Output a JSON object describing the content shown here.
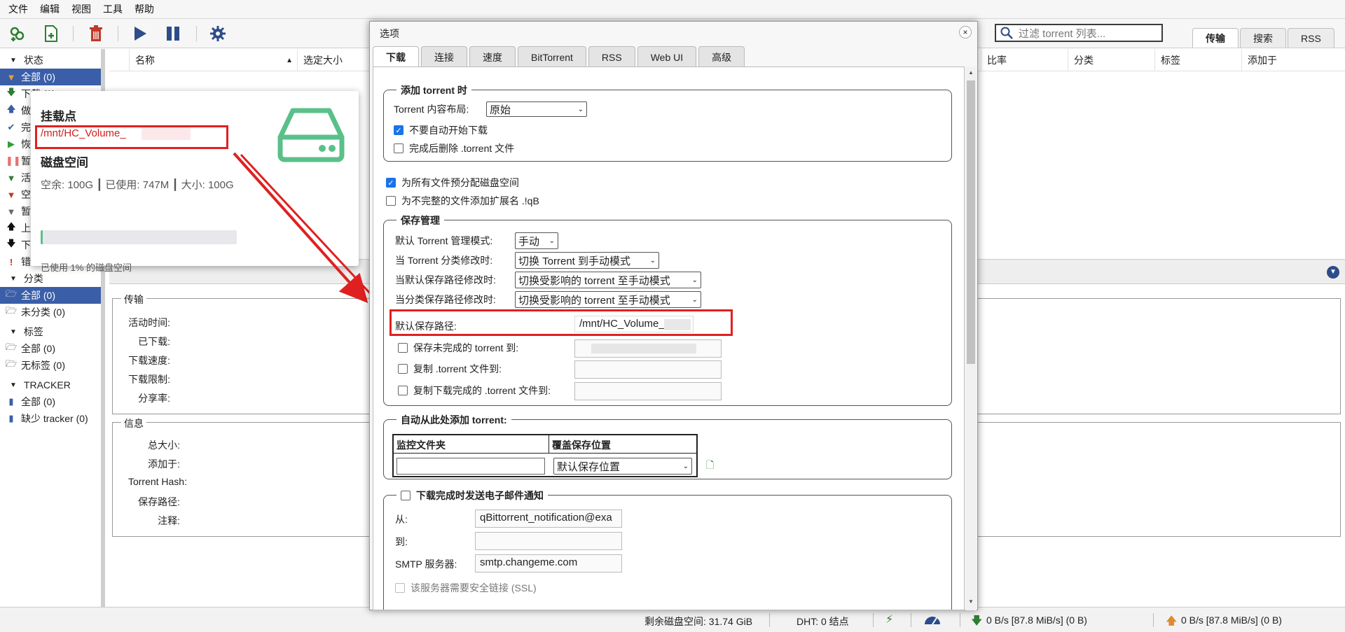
{
  "menu": [
    "文件",
    "编辑",
    "视图",
    "工具",
    "帮助"
  ],
  "toolbar": {
    "icons": [
      "add-link-icon",
      "add-file-icon",
      "delete-icon",
      "resume-icon",
      "pause-icon",
      "settings-icon"
    ]
  },
  "search": {
    "placeholder": "过滤 torrent 列表..."
  },
  "right_tabs": [
    "传输",
    "搜索",
    "RSS"
  ],
  "sidebar": {
    "status_header": "状态",
    "status_items": [
      {
        "label": "全部 (0)"
      },
      {
        "label": "下载 (0)"
      },
      {
        "label": "做种 (0)"
      },
      {
        "label": "完成 (0)"
      },
      {
        "label": "恢复 (0)"
      },
      {
        "label": "暂停 (0)"
      },
      {
        "label": "活动 (0)"
      },
      {
        "label": "空闲 (0)"
      },
      {
        "label": "暂停 (0)"
      },
      {
        "label": "上传 (0)"
      },
      {
        "label": "下载 (0)"
      },
      {
        "label": "错误 (0)"
      }
    ],
    "category_header": "分类",
    "category_items": [
      {
        "label": "全部 (0)"
      },
      {
        "label": "未分类 (0)"
      }
    ],
    "tag_header": "标签",
    "tag_items": [
      {
        "label": "全部 (0)"
      },
      {
        "label": "无标签 (0)"
      }
    ],
    "tracker_header": "TRACKER",
    "tracker_items": [
      {
        "label": "全部 (0)"
      },
      {
        "label": "缺少 tracker (0)"
      }
    ]
  },
  "list_columns": {
    "name": "名称",
    "size": "选定大小",
    "ratio": "比率",
    "category": "分类",
    "tags": "标签",
    "added": "添加于"
  },
  "props": {
    "transfer_legend": "传输",
    "transfer_rows": [
      "活动时间:",
      "已下载:",
      "下载速度:",
      "下载限制:",
      "分享率:"
    ],
    "info_legend": "信息",
    "info_rows": [
      "总大小:",
      "添加于:",
      "Torrent Hash:",
      "保存路径:",
      "注释:"
    ]
  },
  "popup": {
    "mount_title": "挂载点",
    "mount_path": "/mnt/HC_Volume_",
    "disk_title": "磁盘空间",
    "disk_detail": "空余: 100G ┃ 已使用: 747M ┃ 大小: 100G",
    "usage_percent": 1,
    "usage_text": "已使用 1% 的磁盘空间",
    "accent": "#5ac08a"
  },
  "dialog": {
    "title": "选项",
    "close": "×",
    "tabs": [
      "下载",
      "连接",
      "速度",
      "BitTorrent",
      "RSS",
      "Web UI",
      "高级"
    ],
    "add_torrent": {
      "legend": "添加 torrent 时",
      "layout_label": "Torrent 内容布局:",
      "layout_value": "原始",
      "no_autostart": "不要自动开始下载",
      "delete_after": "完成后删除 .torrent 文件"
    },
    "prealloc": "为所有文件预分配磁盘空间",
    "append_ext": "为不完整的文件添加扩展名 .!qB",
    "save": {
      "legend": "保存管理",
      "mode_label": "默认 Torrent 管理模式:",
      "mode_value": "手动",
      "cat_changed_label": "当 Torrent 分类修改时:",
      "cat_changed_value": "切换 Torrent 到手动模式",
      "default_path_changed_label": "当默认保存路径修改时:",
      "default_path_changed_value": "切换受影响的 torrent 至手动模式",
      "cat_path_changed_label": "当分类保存路径修改时:",
      "cat_path_changed_value": "切换受影响的 torrent 至手动模式",
      "default_path_label": "默认保存路径:",
      "default_path_value": "/mnt/HC_Volume_",
      "incomplete_label": "保存未完成的 torrent 到:",
      "copy_torrent_label": "复制 .torrent 文件到:",
      "copy_finished_label": "复制下载完成的 .torrent 文件到:"
    },
    "auto_add": {
      "legend": "自动从此处添加 torrent:",
      "col_watch": "监控文件夹",
      "col_override": "覆盖保存位置",
      "override_value": "默认保存位置"
    },
    "email": {
      "legend": "下载完成时发送电子邮件通知",
      "from_label": "从:",
      "from_value": "qBittorrent_notification@exa",
      "to_label": "到:",
      "smtp_label": "SMTP 服务器:",
      "smtp_value": "smtp.changeme.com",
      "ssl_label": "该服务器需要安全链接 (SSL)"
    }
  },
  "status": {
    "free_space": "剩余磁盘空间: 31.74 GiB",
    "dht": "DHT: 0 结点",
    "down": "0 B/s [87.8 MiB/s] (0 B)",
    "up": "0 B/s [87.8 MiB/s] (0 B)"
  },
  "colors": {
    "selection": "#3a5ea8",
    "highlight": "#e02020"
  }
}
